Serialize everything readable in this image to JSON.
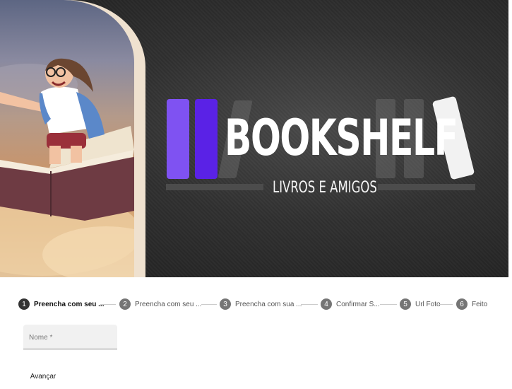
{
  "hero": {
    "logo_title": "BOOKSHELF",
    "logo_subtitle": "LIVROS E AMIGOS",
    "colors": {
      "bar_light": "#7f52f2",
      "bar_dark": "#5a22e6",
      "background": "#2a2a2a"
    }
  },
  "stepper": {
    "steps": [
      {
        "number": "1",
        "label": "Preencha com seu ...",
        "active": true
      },
      {
        "number": "2",
        "label": "Preencha com seu ..."
      },
      {
        "number": "3",
        "label": "Preencha com sua ..."
      },
      {
        "number": "4",
        "label": "Confirmar S..."
      },
      {
        "number": "5",
        "label": "Url Foto"
      },
      {
        "number": "6",
        "label": "Feito"
      }
    ]
  },
  "form": {
    "name_label": "Nome *",
    "name_value": "",
    "next_label": "Avançar"
  }
}
